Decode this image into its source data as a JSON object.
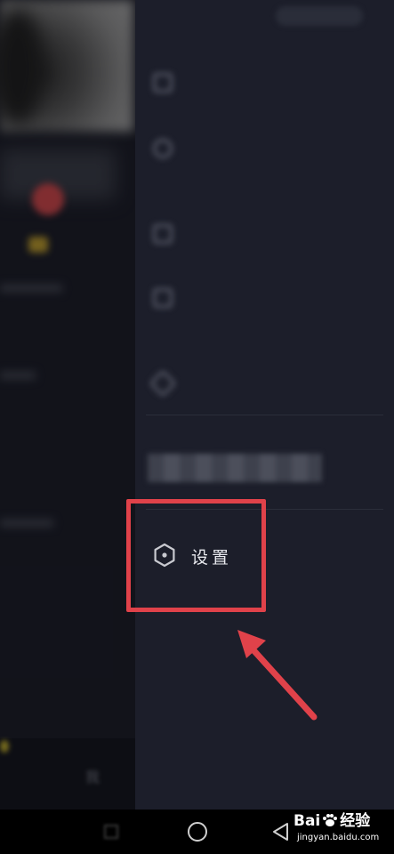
{
  "drawer": {
    "blurred_items": [
      "",
      "",
      "",
      "",
      ""
    ],
    "settings_label": "设置"
  },
  "colors": {
    "highlight": "#e0424a",
    "drawer_bg": "#1c1e2a",
    "page_bg": "#161823"
  },
  "icons": {
    "settings": "hexagon-gear-icon",
    "nav_recent": "square-icon",
    "nav_home": "circle-icon",
    "nav_back": "back-triangle-icon"
  },
  "watermark": {
    "brand_prefix": "Bai",
    "brand_suffix": "经验",
    "url": "jingyan.baidu.com"
  }
}
